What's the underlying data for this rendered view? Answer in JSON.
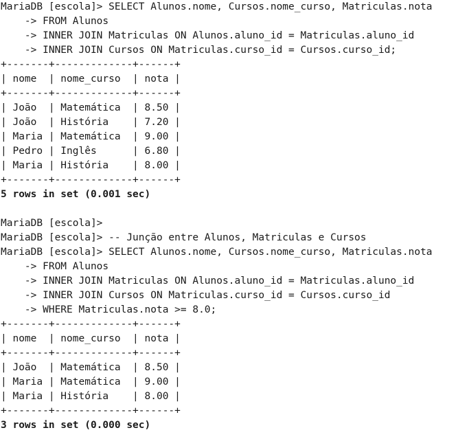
{
  "terminal": {
    "lines": [
      {
        "text": "MariaDB [escola]> SELECT Alunos.nome, Cursos.nome_curso, Matriculas.nota",
        "kind": "input"
      },
      {
        "text": "    -> FROM Alunos",
        "kind": "input"
      },
      {
        "text": "    -> INNER JOIN Matriculas ON Alunos.aluno_id = Matriculas.aluno_id",
        "kind": "input"
      },
      {
        "text": "    -> INNER JOIN Cursos ON Matriculas.curso_id = Cursos.curso_id;",
        "kind": "input"
      },
      {
        "text": "+-------+-------------+------+",
        "kind": "table"
      },
      {
        "text": "| nome  | nome_curso  | nota |",
        "kind": "table"
      },
      {
        "text": "+-------+-------------+------+",
        "kind": "table"
      },
      {
        "text": "| João  | Matemática  | 8.50 |",
        "kind": "table"
      },
      {
        "text": "| João  | História    | 7.20 |",
        "kind": "table"
      },
      {
        "text": "| Maria | Matemática  | 9.00 |",
        "kind": "table"
      },
      {
        "text": "| Pedro | Inglês      | 6.80 |",
        "kind": "table"
      },
      {
        "text": "| Maria | História    | 8.00 |",
        "kind": "table"
      },
      {
        "text": "+-------+-------------+------+",
        "kind": "table"
      },
      {
        "text": "5 rows in set (0.001 sec)",
        "kind": "result"
      },
      {
        "text": "",
        "kind": "blank"
      },
      {
        "text": "MariaDB [escola]>",
        "kind": "input"
      },
      {
        "text": "MariaDB [escola]> -- Junção entre Alunos, Matriculas e Cursos",
        "kind": "input"
      },
      {
        "text": "MariaDB [escola]> SELECT Alunos.nome, Cursos.nome_curso, Matriculas.nota",
        "kind": "input"
      },
      {
        "text": "    -> FROM Alunos",
        "kind": "input"
      },
      {
        "text": "    -> INNER JOIN Matriculas ON Alunos.aluno_id = Matriculas.aluno_id",
        "kind": "input"
      },
      {
        "text": "    -> INNER JOIN Cursos ON Matriculas.curso_id = Cursos.curso_id",
        "kind": "input"
      },
      {
        "text": "    -> WHERE Matriculas.nota >= 8.0;",
        "kind": "input"
      },
      {
        "text": "+-------+-------------+------+",
        "kind": "table"
      },
      {
        "text": "| nome  | nome_curso  | nota |",
        "kind": "table"
      },
      {
        "text": "+-------+-------------+------+",
        "kind": "table"
      },
      {
        "text": "| João  | Matemática  | 8.50 |",
        "kind": "table"
      },
      {
        "text": "| Maria | Matemática  | 9.00 |",
        "kind": "table"
      },
      {
        "text": "| Maria | História    | 8.00 |",
        "kind": "table"
      },
      {
        "text": "+-------+-------------+------+",
        "kind": "table"
      },
      {
        "text": "3 rows in set (0.000 sec)",
        "kind": "result"
      }
    ]
  }
}
